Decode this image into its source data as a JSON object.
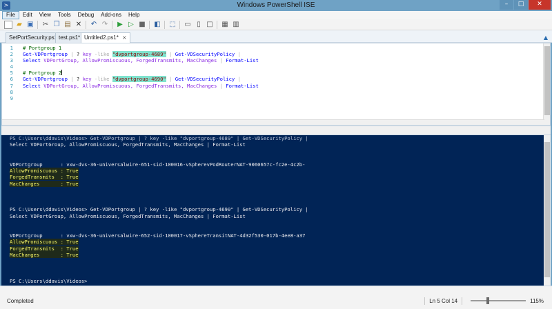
{
  "window": {
    "title": "Windows PowerShell ISE",
    "app_icon": "powershell-icon",
    "buttons": {
      "minimize": "–",
      "maximize": "□",
      "close": "✕"
    }
  },
  "menu": [
    "File",
    "Edit",
    "View",
    "Tools",
    "Debug",
    "Add-ons",
    "Help"
  ],
  "tabs": [
    {
      "label": "SetPortSecurity.ps1",
      "active": false
    },
    {
      "label": "test.ps1*",
      "active": false
    },
    {
      "label": "Untitled2.ps1*",
      "active": true,
      "close": "×"
    }
  ],
  "script_lines": [
    {
      "n": "1",
      "tokens": [
        [
          "cm",
          "# Portgroup 1"
        ]
      ]
    },
    {
      "n": "2",
      "tokens": [
        [
          "cmd",
          "Get-VDPortgroup"
        ],
        [
          "op",
          " | "
        ],
        [
          "plain",
          "? "
        ],
        [
          "arg",
          "key"
        ],
        [
          "plain",
          " "
        ],
        [
          "op",
          "-like"
        ],
        [
          "plain",
          " "
        ],
        [
          "str",
          "\"dvportgroup-4689\""
        ],
        [
          "op",
          " | "
        ],
        [
          "cmd",
          "Get-VDSecurityPolicy"
        ],
        [
          "op",
          " |"
        ]
      ]
    },
    {
      "n": "3",
      "tokens": [
        [
          "cmd",
          "Select"
        ],
        [
          "plain",
          " "
        ],
        [
          "arg",
          "VDPortGroup, AllowPromiscuous, ForgedTransmits, MacChanges"
        ],
        [
          "op",
          " | "
        ],
        [
          "cmd",
          "Format-List"
        ]
      ]
    },
    {
      "n": "4",
      "tokens": []
    },
    {
      "n": "5",
      "tokens": [
        [
          "cm",
          "# Portgroup 2"
        ]
      ],
      "caret": true
    },
    {
      "n": "6",
      "tokens": [
        [
          "cmd",
          "Get-VDPortgroup"
        ],
        [
          "op",
          " | "
        ],
        [
          "plain",
          "? "
        ],
        [
          "arg",
          "key"
        ],
        [
          "plain",
          " "
        ],
        [
          "op",
          "-like"
        ],
        [
          "plain",
          " "
        ],
        [
          "str",
          "\"dvportgroup-4690\""
        ],
        [
          "op",
          " | "
        ],
        [
          "cmd",
          "Get-VDSecurityPolicy"
        ],
        [
          "op",
          " |"
        ]
      ]
    },
    {
      "n": "7",
      "tokens": [
        [
          "cmd",
          "Select"
        ],
        [
          "plain",
          " "
        ],
        [
          "arg",
          "VDPortGroup, AllowPromiscuous, ForgedTransmits, MacChanges"
        ],
        [
          "op",
          " | "
        ],
        [
          "cmd",
          "Format-List"
        ]
      ]
    },
    {
      "n": "8",
      "tokens": []
    },
    {
      "n": "9",
      "tokens": []
    }
  ],
  "console_lines": [
    {
      "text": "PS C:\\Users\\ddavis\\Videos> Get-VDPortgroup | ? key -like \"dvportgroup-4689\" | Get-VDSecurityPolicy |",
      "cut": true
    },
    {
      "text": "Select VDPortGroup, AllowPromiscuous, ForgedTransmits, MacChanges | Format-List"
    },
    {
      "text": ""
    },
    {
      "text": ""
    },
    {
      "text": "VDPortgroup      : vxw-dvs-36-universalwire-651-sid-100016-vSpherevPodRouterNAT-9060657c-fc2e-4c2b-"
    },
    {
      "text": "AllowPromiscuous : True",
      "hl": true
    },
    {
      "text": "ForgedTransmits  : True",
      "hl": true
    },
    {
      "text": "MacChanges       : True",
      "hl": true
    },
    {
      "text": ""
    },
    {
      "text": ""
    },
    {
      "text": ""
    },
    {
      "text": "PS C:\\Users\\ddavis\\Videos> Get-VDPortgroup | ? key -like \"dvportgroup-4690\" | Get-VDSecurityPolicy |"
    },
    {
      "text": "Select VDPortGroup, AllowPromiscuous, ForgedTransmits, MacChanges | Format-List"
    },
    {
      "text": ""
    },
    {
      "text": ""
    },
    {
      "text": "VDPortgroup      : vxw-dvs-36-universalwire-652-sid-100017-vSphereTransitNAT-4d32f530-017b-4ee8-a37"
    },
    {
      "text": "AllowPromiscuous : True",
      "hl": true
    },
    {
      "text": "ForgedTransmits  : True",
      "hl": true
    },
    {
      "text": "MacChanges       : True",
      "hl": true
    },
    {
      "text": ""
    },
    {
      "text": ""
    },
    {
      "text": ""
    },
    {
      "text": "PS C:\\Users\\ddavis\\Videos>"
    }
  ],
  "status": {
    "text": "Completed",
    "position": "Ln 5  Col 14",
    "zoom": "115%",
    "zoom_fraction": 0.3
  },
  "colors": {
    "console_bg": "#012456",
    "string_highlight": "#7fe3ce",
    "accent": "#6fa2c5"
  }
}
